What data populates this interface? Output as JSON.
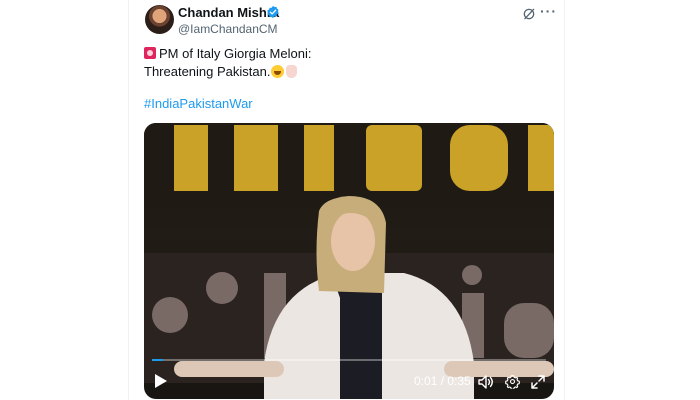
{
  "author": {
    "name": "Chandan Mishra",
    "handle": "@IamChandanCM",
    "verified": true
  },
  "tweet": {
    "text_line1": "PM of Italy Giorgia Meloni:",
    "text_line2": "Threatening Pakistan.",
    "hashtag": "#IndiaPakistanWar"
  },
  "video": {
    "current_time": "0:01",
    "duration": "0:35",
    "time_separator": " / ",
    "progress_fraction": 0.029
  },
  "icons": {
    "verified": "verified-badge-icon",
    "grok": "grok-icon",
    "more": "more-icon",
    "play": "play-icon",
    "volume": "volume-icon",
    "settings": "gear-icon",
    "fullscreen": "fullscreen-icon"
  },
  "colors": {
    "accent": "#1d9bf0",
    "text": "#0f1419",
    "secondary_text": "#536471",
    "stage_gold": "#c9a227"
  }
}
